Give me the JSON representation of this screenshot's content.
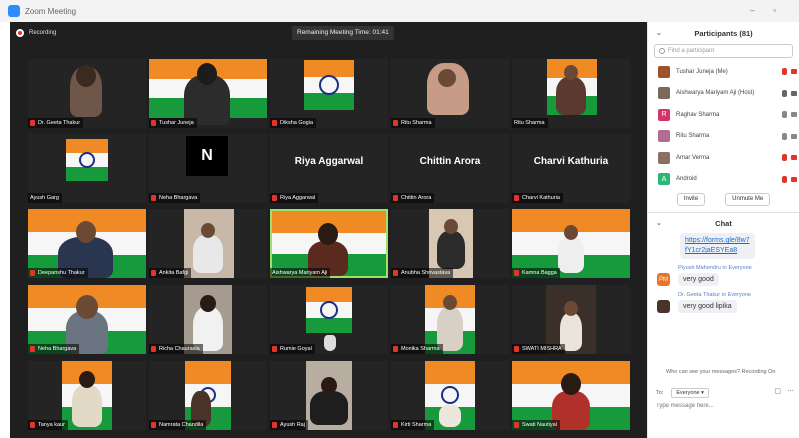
{
  "window": {
    "title": "Zoom Meeting"
  },
  "meeting": {
    "recording_label": "Recording",
    "remaining_time": "Remaining Meeting Time: 01:41"
  },
  "tiles": [
    {
      "name": "Dr. Geeta Thakur"
    },
    {
      "name": "Tushar Juneja"
    },
    {
      "name": "Diksha Gogia"
    },
    {
      "name": "Ritu Sharma"
    },
    {
      "name": "Ritu Sharma"
    },
    {
      "name": "Ayush Garg"
    },
    {
      "name": "Neha Bhargava",
      "initial": "N"
    },
    {
      "name": "Riya Aggarwal",
      "display_name": "Riya Aggarwal"
    },
    {
      "name": "Chittin Arora",
      "display_name": "Chittin Arora"
    },
    {
      "name": "Charvi Kathuria",
      "display_name": "Charvi Kathuria"
    },
    {
      "name": "Deepanshu Thakur"
    },
    {
      "name": "Ankita Bafgi"
    },
    {
      "name": "Aishwarya Mariyam Aji"
    },
    {
      "name": "Anubha Shrivastava"
    },
    {
      "name": "Kamna Bagga"
    },
    {
      "name": "Neha Bhargava"
    },
    {
      "name": "Richa Chaurasia"
    },
    {
      "name": "Rumie Goyal"
    },
    {
      "name": "Monika Sharma"
    },
    {
      "name": "SWATI MISHRA"
    },
    {
      "name": "Tanya kaur"
    },
    {
      "name": "Namrata Chandila"
    },
    {
      "name": "Ayush Raj"
    },
    {
      "name": "Kirti Sharma"
    },
    {
      "name": "Swati Nautiyal"
    }
  ],
  "participants": {
    "title": "Participants (81)",
    "search_placeholder": "Find a participant",
    "list": [
      {
        "name": "Tushar Juneja (Me)"
      },
      {
        "name": "Aishwarya Mariyam Aji (Host)"
      },
      {
        "name": "Raghav Sharma",
        "initial": "R"
      },
      {
        "name": "Ritu Sharma"
      },
      {
        "name": "Amar Verma"
      },
      {
        "name": "Android",
        "initial": "A"
      }
    ],
    "invite_label": "Invite",
    "unmute_label": "Unmute Me"
  },
  "chat": {
    "title": "Chat",
    "link_text": "https://forms.gle/8w7fY1cr2jaESYEa8",
    "messages": [
      {
        "sender": "Piyush Mahendru",
        "to_word": "to",
        "recipient": "Everyone",
        "text": "very good",
        "initials": "PM"
      },
      {
        "sender": "Dr. Geeta Thakur",
        "to_word": "to",
        "recipient": "Everyone",
        "text": "very good lipika"
      }
    ],
    "visibility_note": "Who can see your messages? Recording On",
    "to_label": "To:",
    "to_value": "Everyone",
    "input_placeholder": "Type message here..."
  },
  "colors": {
    "accent": "#2d8cff",
    "mute_red": "#e5322d",
    "speaker_green": "#9be26b"
  }
}
